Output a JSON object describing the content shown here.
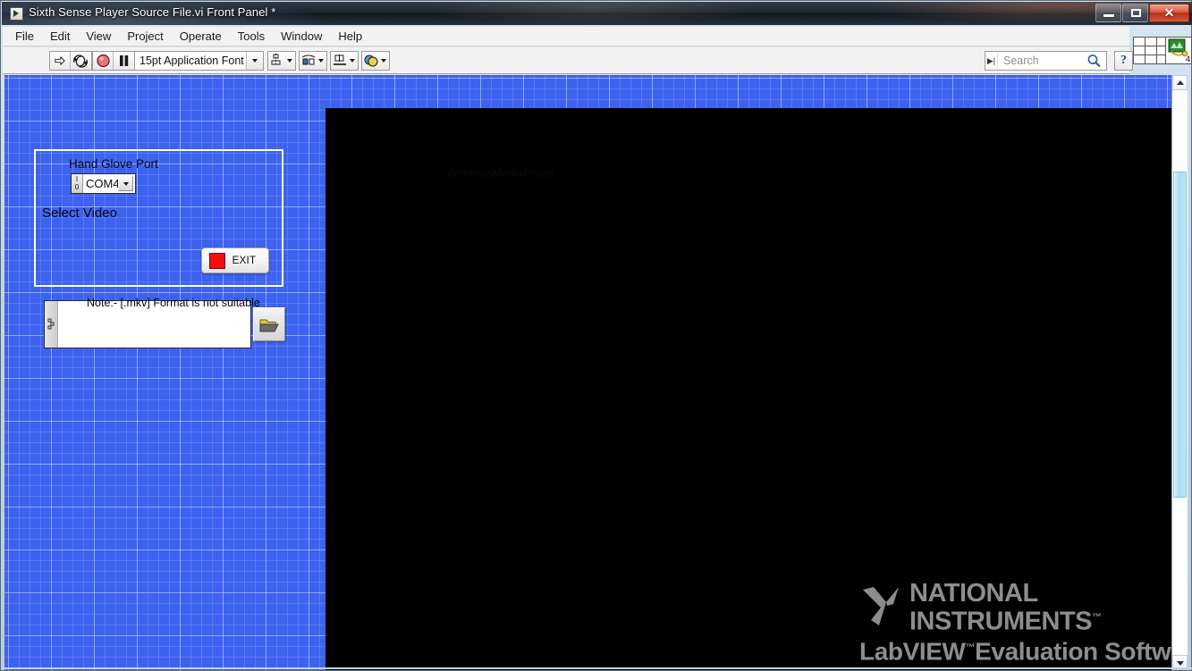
{
  "window": {
    "title": "Sixth Sense Player Source File.vi Front Panel *",
    "app_icon": "labview-vi-icon",
    "minimize_label": "Minimize",
    "restore_label": "Restore",
    "close_label": "✕"
  },
  "menu": {
    "items": [
      {
        "label": "File",
        "name": "menu-file"
      },
      {
        "label": "Edit",
        "name": "menu-edit"
      },
      {
        "label": "View",
        "name": "menu-view"
      },
      {
        "label": "Project",
        "name": "menu-project"
      },
      {
        "label": "Operate",
        "name": "menu-operate"
      },
      {
        "label": "Tools",
        "name": "menu-tools"
      },
      {
        "label": "Window",
        "name": "menu-window"
      },
      {
        "label": "Help",
        "name": "menu-help"
      }
    ]
  },
  "toolbar": {
    "run_icon": "run-arrow-icon",
    "run_continuously_icon": "run-continuously-icon",
    "abort_icon": "abort-execution-icon",
    "pause_icon": "pause-icon",
    "font_value": "15pt Application Font",
    "font_dropdown_icon": "chevron-down-icon",
    "align_icon": "align-objects-icon",
    "distribute_icon": "distribute-objects-icon",
    "resize_icon": "resize-objects-icon",
    "reorder_icon": "reorder-objects-icon",
    "search_placeholder": "Search",
    "search_value": "",
    "search_icon": "magnifier-icon",
    "help_label": "?",
    "pane_icon": "window-panes-icon",
    "vi_icon": "vi-connector-pane-icon",
    "vi_icon_number": "4"
  },
  "panel": {
    "background_color": "#3e62f0",
    "grid": "on",
    "decoration_box": "flat-frame-decoration",
    "hand_glove_port": {
      "label": "Hand Glove Port",
      "value": "COM4",
      "io_glyph_top": "I",
      "io_glyph_bottom": "0",
      "dropdown_icon": "chevron-down-icon"
    },
    "exit_button": {
      "label": "EXIT",
      "led_color": "#f40d0d"
    },
    "select_video": {
      "label": "Select  Video",
      "path_value": "",
      "path_glyph": "path-symbol-icon",
      "browse_icon": "folder-open-icon"
    },
    "note": "Note:-  [.mkv] Format is not suitable",
    "media_player": {
      "label": "WindowsMediaPlayer",
      "screen_color": "#000000"
    },
    "watermark": {
      "logo_icon": "national-instruments-eagle-icon",
      "line1": "NATIONAL",
      "line2": "INSTRUMENTS",
      "tm": "™",
      "line3": "LabVIEW",
      "line3_tm": "™",
      "line4": "Evaluation Software",
      "color": "#8d8d8d"
    }
  },
  "scrollbars": {
    "vertical_up_icon": "scroll-up-arrow-icon",
    "vertical_down_icon": "scroll-down-arrow-icon"
  }
}
